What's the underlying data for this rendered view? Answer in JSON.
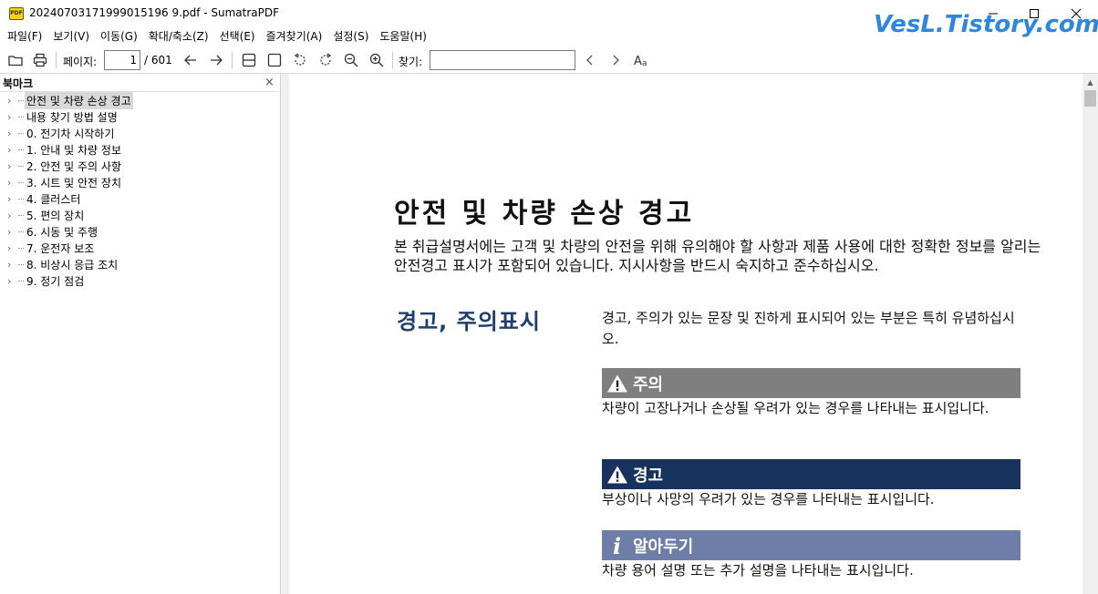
{
  "window": {
    "title": "20240703171999015196 9.pdf - SumatraPDF",
    "app_icon_text": "PDF",
    "watermark": "VesL.Tistory.com"
  },
  "menu": [
    "파일(F)",
    "보기(V)",
    "이동(G)",
    "확대/축소(Z)",
    "선택(E)",
    "즐겨찾기(A)",
    "설정(S)",
    "도움말(H)"
  ],
  "toolbar": {
    "page_label": "페이지:",
    "page_current": "1",
    "page_total": "/ 601",
    "find_label": "찾기:",
    "find_value": ""
  },
  "sidebar": {
    "title": "북마크",
    "close": "×",
    "items": [
      {
        "label": "안전 및 차량 손상 경고",
        "selected": true
      },
      {
        "label": "내용 찾기 방법 설명"
      },
      {
        "label": "0. 전기차 시작하기"
      },
      {
        "label": "1. 안내 및 차량 정보"
      },
      {
        "label": "2. 안전 및 주의 사항"
      },
      {
        "label": "3. 시트 및 안전 장치"
      },
      {
        "label": "4. 클러스터"
      },
      {
        "label": "5. 편의 장치"
      },
      {
        "label": "6. 시동 및 주행"
      },
      {
        "label": "7. 운전자 보조"
      },
      {
        "label": "8. 비상시 응급 조치"
      },
      {
        "label": "9. 정기 점검"
      }
    ]
  },
  "document": {
    "heading": "안전 및 차량 손상 경고",
    "intro": "본 취급설명서에는 고객 및 차량의 안전을 위해 유의해야 할 사항과 제품 사용에 대한 정확한 정보를 알리는 안전경고 표시가 포함되어 있습니다. 지시사항을 반드시 숙지하고 준수하십시오.",
    "section_title": "경고, 주의표시",
    "section_desc": "경고, 주의가 있는 문장 및 진하게 표시되어 있는 부분은 특히 유념하십시오.",
    "caution": {
      "label": "주의",
      "text": "차량이 고장나거나 손상될 우려가 있는 경우를 나타내는 표시입니다."
    },
    "warning": {
      "label": "경고",
      "text": "부상이나 사망의 우려가 있는 경우를 나타내는 표시입니다."
    },
    "note": {
      "label": "알아두기",
      "text": "차량 용어 설명 또는 추가 설명을 나타내는 표시입니다."
    }
  },
  "colors": {
    "caution_bg": "#7f7f7f",
    "warning_bg": "#17325c",
    "note_bg": "#6e7ea8",
    "section_title": "#1f3e6e",
    "watermark": "#2f86dd"
  }
}
